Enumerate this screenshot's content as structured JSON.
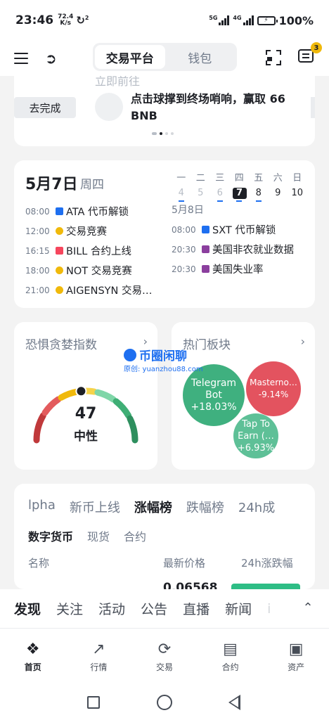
{
  "status_bar": {
    "time": "23:46",
    "speed_value": "72.4",
    "speed_unit": "K/s",
    "sync_badge": "2",
    "net1": "5G",
    "net2": "4G",
    "battery": "100%"
  },
  "top_nav": {
    "segments": [
      "交易平台",
      "钱包"
    ],
    "active_segment": 0,
    "message_badge": "3"
  },
  "promo": {
    "faded_prev_text": "立即前往",
    "button_label": "去完成",
    "text": "点击球撑到终场哨响，赢取 66 BNB"
  },
  "calendar": {
    "date": "5月7日",
    "weekday": "周四",
    "week_days": [
      {
        "label": "一",
        "num": "4",
        "state": "past",
        "dot": true
      },
      {
        "label": "二",
        "num": "5",
        "state": "past",
        "dot": false
      },
      {
        "label": "三",
        "num": "6",
        "state": "past",
        "dot": true
      },
      {
        "label": "四",
        "num": "7",
        "state": "today",
        "dot": true
      },
      {
        "label": "五",
        "num": "8",
        "state": "future",
        "dot": true
      },
      {
        "label": "六",
        "num": "9",
        "state": "future",
        "dot": false
      },
      {
        "label": "日",
        "num": "10",
        "state": "future",
        "dot": false
      }
    ],
    "today_events": [
      {
        "time": "08:00",
        "icon": "lock-icon",
        "title": "ATA 代币解锁"
      },
      {
        "time": "12:00",
        "icon": "coin-icon",
        "title": "交易竞赛"
      },
      {
        "time": "16:15",
        "icon": "doc-icon",
        "title": "BILL 合约上线"
      },
      {
        "time": "18:00",
        "icon": "coin-icon",
        "title": "NOT 交易竞赛"
      },
      {
        "time": "21:00",
        "icon": "coin-icon",
        "title": "AIGENSYN 交易…"
      }
    ],
    "next_date": "5月8日",
    "next_events": [
      {
        "time": "08:00",
        "icon": "lock-icon",
        "title": "SXT 代币解锁"
      },
      {
        "time": "20:30",
        "icon": "bank-icon",
        "title": "美国非农就业数据"
      },
      {
        "time": "20:30",
        "icon": "bank-icon",
        "title": "美国失业率"
      }
    ]
  },
  "fear_greed": {
    "title": "恐惧贪婪指数",
    "value": 47,
    "value_text": "47",
    "label": "中性",
    "scale_max": 100
  },
  "hot_sectors": {
    "title": "热门板块",
    "bubbles": [
      {
        "name": "Telegram Bot",
        "change": "+18.03%",
        "color": "#3fb07f"
      },
      {
        "name": "Masterno…",
        "change": "-9.14%",
        "color": "#e3535f"
      },
      {
        "name": "Tap To Earn (…",
        "change": "+6.93%",
        "color": "#5ec097"
      }
    ]
  },
  "watermark": {
    "title": "币圈闲聊",
    "sub": "原创: yuanzhou88.com"
  },
  "market": {
    "tabs": [
      "lpha",
      "新币上线",
      "涨幅榜",
      "跌幅榜",
      "24h成"
    ],
    "active_tab": 2,
    "subtabs": [
      "数字货币",
      "现货",
      "合约"
    ],
    "active_subtab": 0,
    "columns": [
      "名称",
      "最新价格",
      "24h涨跌幅"
    ],
    "first_row_price": "0.06568"
  },
  "feed_tabs": {
    "items": [
      "发现",
      "关注",
      "活动",
      "公告",
      "直播",
      "新闻",
      "i"
    ],
    "active": 0
  },
  "bottom_nav": {
    "items": [
      {
        "label": "首页",
        "icon": "home-icon"
      },
      {
        "label": "行情",
        "icon": "chart-icon"
      },
      {
        "label": "交易",
        "icon": "trade-icon"
      },
      {
        "label": "合约",
        "icon": "futures-icon"
      },
      {
        "label": "资产",
        "icon": "wallet-icon"
      }
    ],
    "active": 0
  },
  "colors": {
    "accent": "#f0b90b",
    "up": "#2ebd85",
    "down": "#f6465d",
    "link": "#1e6ff0"
  }
}
